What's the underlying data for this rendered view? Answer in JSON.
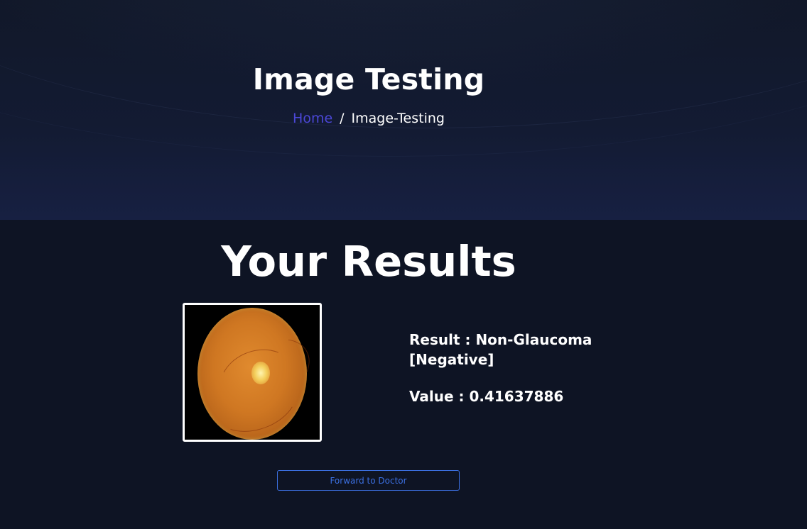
{
  "hero": {
    "title": "Image Testing",
    "breadcrumb": {
      "home_label": "Home",
      "separator": "/",
      "current_label": "Image-Testing"
    }
  },
  "results": {
    "title": "Your Results",
    "result_text": "Result : Non-Glaucoma [Negative]",
    "value_text": "Value : 0.41637886",
    "forward_button_label": "Forward to Doctor"
  },
  "colors": {
    "background": "#0e1424",
    "hero_background": "#131b33",
    "link_accent": "#4b47d6",
    "button_accent": "#3b6fe0",
    "text": "#ffffff"
  },
  "icons": {
    "result_image": "retinal-fundus-image"
  }
}
